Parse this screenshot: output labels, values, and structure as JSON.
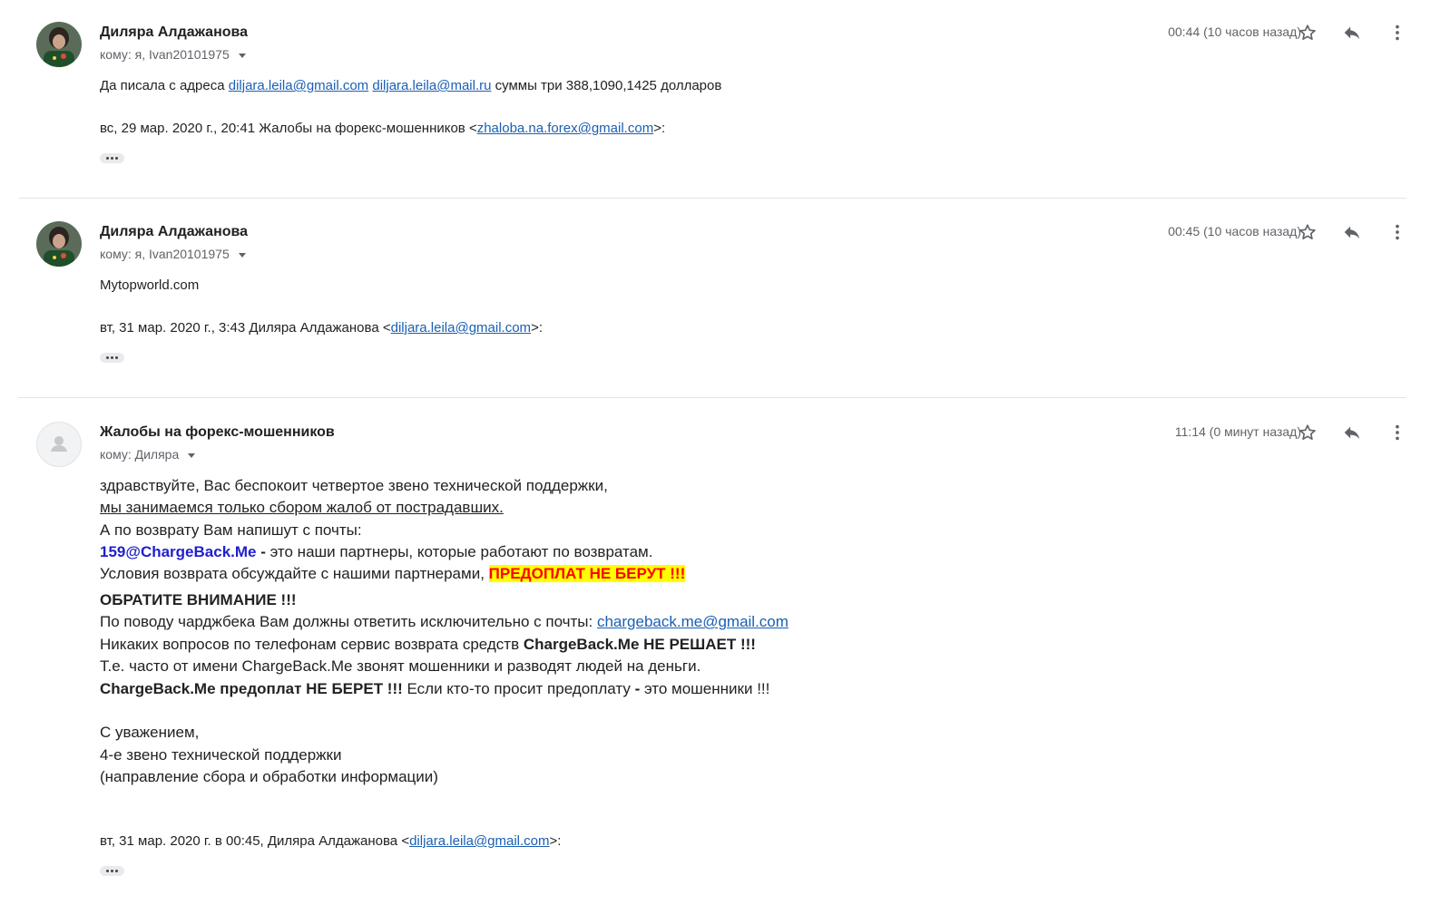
{
  "messages": [
    {
      "sender": "Диляра Алдажанова",
      "to": "кому: я, Ivan20101975",
      "time": "00:44 (10 часов назад)",
      "body_prefix": "Да писала с адреса ",
      "link1": "diljara.leila@gmail.com",
      "link2": "diljara.leila@mail.ru",
      "body_suffix": " суммы три 388,1090,1425 долларов",
      "quote_prefix": "вс, 29 мар. 2020 г., 20:41 Жалобы на форекс-мошенников <",
      "quote_link": "zhaloba.na.forex@gmail.com",
      "quote_suffix": ">:"
    },
    {
      "sender": "Диляра Алдажанова",
      "to": "кому: я, Ivan20101975",
      "time": "00:45 (10 часов назад)",
      "body": "Mytopworld.com",
      "quote_prefix": "вт, 31 мар. 2020 г., 3:43 Диляра Алдажанова <",
      "quote_link": "diljara.leila@gmail.com",
      "quote_suffix": ">:"
    },
    {
      "sender": "Жалобы на форекс-мошенников",
      "to": "кому: Диляра",
      "time": "11:14 (0 минут назад)",
      "l1": "здравствуйте, Вас беспокоит четвертое звено технической поддержки,",
      "l2": "мы занимаемся только сбором жалоб от пострадавших.",
      "l3": "А по возврату Вам напишут с почты:",
      "l4_email": "159@ChargeBack.Me",
      "l4_dash": " - ",
      "l4_rest": "это наши партнеры, которые работают по возвратам.",
      "l5_pre": "Условия возврата обсуждайте с нашими партнерами, ",
      "l5_hl": "ПРЕДОПЛАТ НЕ БЕРУТ !!!",
      "l6": "ОБРАТИТЕ ВНИМАНИЕ !!!",
      "l7_pre": "По поводу чарджбека Вам должны ответить исключительно с почты: ",
      "l7_link": "chargeback.me@gmail.com",
      "l8_pre": "Никаких вопросов по телефонам сервис возврата средств ",
      "l8_bold": "ChargeBack.Me НЕ РЕШАЕТ !!!",
      "l9": "Т.е. часто от имени ChargeBack.Me звонят мошенники и разводят людей на деньги.",
      "l10_bold": "ChargeBack.Me предоплат НЕ БЕРЕТ !!!",
      "l10_mid": " Если кто-то просит предоплату ",
      "l10_dash": "-",
      "l10_end": " это мошенники !!!",
      "sig1": "С уважением,",
      "sig2": "4-е звено технической поддержки",
      "sig3": "(направление сбора и обработки информации)",
      "quote_prefix": "вт, 31 мар. 2020 г. в 00:45, Диляра Алдажанова <",
      "quote_link": "diljara.leila@gmail.com",
      "quote_suffix": ">:"
    }
  ],
  "icons": {
    "star": "star-icon",
    "reply": "reply-icon",
    "more": "more-vertical-icon",
    "dropdown": "chevron-down-icon",
    "expand": "ellipsis-icon"
  },
  "colors": {
    "link": "#1a5fb4",
    "email_highlight": "#1f1fcf",
    "warning_bg": "#ffff00",
    "warning_text": "#ff0000",
    "secondary_text": "#5f6368"
  }
}
